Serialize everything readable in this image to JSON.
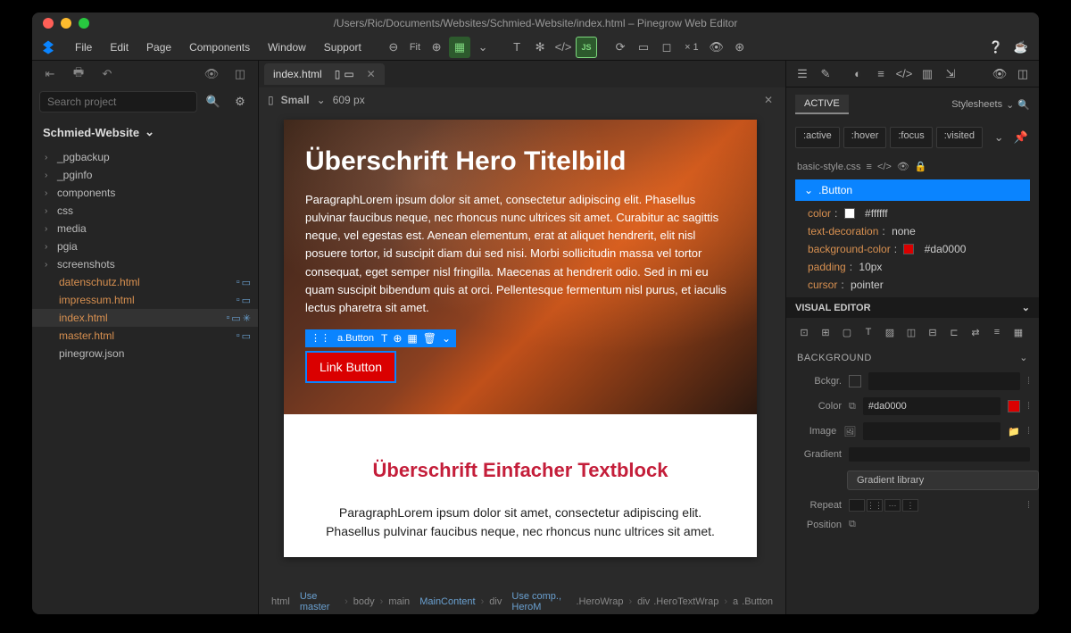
{
  "title": "/Users/Ric/Documents/Websites/Schmied-Website/index.html – Pinegrow Web Editor",
  "menu": [
    "File",
    "Edit",
    "Page",
    "Components",
    "Window",
    "Support"
  ],
  "fit_label": "Fit",
  "zoom_label": "× 1",
  "search_placeholder": "Search project",
  "project_name": "Schmied-Website",
  "tree": {
    "folders": [
      "_pgbackup",
      "_pginfo",
      "components",
      "css",
      "media",
      "pgia",
      "screenshots"
    ],
    "files": [
      "datenschutz.html",
      "impressum.html",
      "index.html",
      "master.html",
      "pinegrow.json"
    ]
  },
  "tab_name": "index.html",
  "view": {
    "size_label": "Small",
    "px": "609 px"
  },
  "hero": {
    "title": "Überschrift Hero Titelbild",
    "paragraph": "ParagraphLorem ipsum dolor sit amet, consectetur adipiscing elit. Phasellus pulvinar faucibus neque, nec rhoncus nunc ultrices sit amet. Curabitur ac sagittis neque, vel egestas est. Aenean elementum, erat at aliquet hendrerit, elit nisl posuere tortor, id suscipit diam dui sed nisi. Morbi sollicitudin massa vel tortor consequat, eget semper nisl fringilla. Maecenas at hendrerit odio. Sed in mi eu quam suscipit bibendum quis at orci. Pellentesque fermentum nisl purus, et iaculis lectus pharetra sit amet.",
    "chip_label": "a.Button",
    "button_label": "Link Button"
  },
  "textblock": {
    "title": "Überschrift Einfacher Textblock",
    "paragraph": "ParagraphLorem ipsum dolor sit amet, consectetur adipiscing elit. Phasellus pulvinar faucibus neque, nec rhoncus nunc ultrices sit amet."
  },
  "breadcrumb": [
    {
      "t": "html",
      "a": "Use master"
    },
    {
      "t": "body"
    },
    {
      "t": "main",
      "a": "MainContent"
    },
    {
      "t": "div",
      "a": "Use comp., HeroM",
      "s": ".HeroWrap"
    },
    {
      "t": "div",
      "s": ".HeroTextWrap"
    },
    {
      "t": "a",
      "s": ".Button"
    }
  ],
  "css_panel": {
    "active_tab": "ACTIVE",
    "stylesheets_label": "Stylesheets",
    "states": [
      ":active",
      ":hover",
      ":focus",
      ":visited"
    ],
    "file": "basic-style.css",
    "selector": ".Button",
    "props": [
      {
        "name": "color",
        "value": "#ffffff",
        "swatch": "#ffffff"
      },
      {
        "name": "text-decoration",
        "value": "none"
      },
      {
        "name": "background-color",
        "value": "#da0000",
        "swatch": "#da0000"
      },
      {
        "name": "padding",
        "value": "10px"
      },
      {
        "name": "cursor",
        "value": "pointer"
      }
    ],
    "visual_editor": "VISUAL EDITOR",
    "background_section": "BACKGROUND",
    "bg": {
      "bckgr": "Bckgr.",
      "color_label": "Color",
      "color_value": "#da0000",
      "image_label": "Image",
      "gradient_label": "Gradient",
      "gradient_lib": "Gradient library",
      "repeat_label": "Repeat",
      "position_label": "Position"
    }
  }
}
